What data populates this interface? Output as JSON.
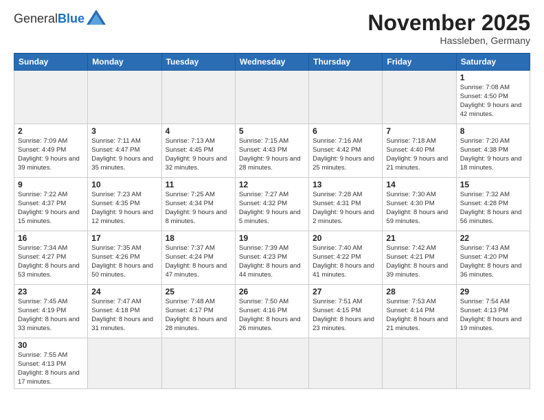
{
  "logo": {
    "general": "General",
    "blue": "Blue"
  },
  "title": {
    "month_year": "November 2025",
    "location": "Hassleben, Germany"
  },
  "weekdays": [
    "Sunday",
    "Monday",
    "Tuesday",
    "Wednesday",
    "Thursday",
    "Friday",
    "Saturday"
  ],
  "weeks": [
    [
      {
        "day": "",
        "info": "",
        "empty": true
      },
      {
        "day": "",
        "info": "",
        "empty": true
      },
      {
        "day": "",
        "info": "",
        "empty": true
      },
      {
        "day": "",
        "info": "",
        "empty": true
      },
      {
        "day": "",
        "info": "",
        "empty": true
      },
      {
        "day": "",
        "info": "",
        "empty": true
      },
      {
        "day": "1",
        "info": "Sunrise: 7:08 AM\nSunset: 4:50 PM\nDaylight: 9 hours\nand 42 minutes."
      }
    ],
    [
      {
        "day": "2",
        "info": "Sunrise: 7:09 AM\nSunset: 4:49 PM\nDaylight: 9 hours\nand 39 minutes."
      },
      {
        "day": "3",
        "info": "Sunrise: 7:11 AM\nSunset: 4:47 PM\nDaylight: 9 hours\nand 35 minutes."
      },
      {
        "day": "4",
        "info": "Sunrise: 7:13 AM\nSunset: 4:45 PM\nDaylight: 9 hours\nand 32 minutes."
      },
      {
        "day": "5",
        "info": "Sunrise: 7:15 AM\nSunset: 4:43 PM\nDaylight: 9 hours\nand 28 minutes."
      },
      {
        "day": "6",
        "info": "Sunrise: 7:16 AM\nSunset: 4:42 PM\nDaylight: 9 hours\nand 25 minutes."
      },
      {
        "day": "7",
        "info": "Sunrise: 7:18 AM\nSunset: 4:40 PM\nDaylight: 9 hours\nand 21 minutes."
      },
      {
        "day": "8",
        "info": "Sunrise: 7:20 AM\nSunset: 4:38 PM\nDaylight: 9 hours\nand 18 minutes."
      }
    ],
    [
      {
        "day": "9",
        "info": "Sunrise: 7:22 AM\nSunset: 4:37 PM\nDaylight: 9 hours\nand 15 minutes."
      },
      {
        "day": "10",
        "info": "Sunrise: 7:23 AM\nSunset: 4:35 PM\nDaylight: 9 hours\nand 12 minutes."
      },
      {
        "day": "11",
        "info": "Sunrise: 7:25 AM\nSunset: 4:34 PM\nDaylight: 9 hours\nand 8 minutes."
      },
      {
        "day": "12",
        "info": "Sunrise: 7:27 AM\nSunset: 4:32 PM\nDaylight: 9 hours\nand 5 minutes."
      },
      {
        "day": "13",
        "info": "Sunrise: 7:28 AM\nSunset: 4:31 PM\nDaylight: 9 hours\nand 2 minutes."
      },
      {
        "day": "14",
        "info": "Sunrise: 7:30 AM\nSunset: 4:30 PM\nDaylight: 8 hours\nand 59 minutes."
      },
      {
        "day": "15",
        "info": "Sunrise: 7:32 AM\nSunset: 4:28 PM\nDaylight: 8 hours\nand 56 minutes."
      }
    ],
    [
      {
        "day": "16",
        "info": "Sunrise: 7:34 AM\nSunset: 4:27 PM\nDaylight: 8 hours\nand 53 minutes."
      },
      {
        "day": "17",
        "info": "Sunrise: 7:35 AM\nSunset: 4:26 PM\nDaylight: 8 hours\nand 50 minutes."
      },
      {
        "day": "18",
        "info": "Sunrise: 7:37 AM\nSunset: 4:24 PM\nDaylight: 8 hours\nand 47 minutes."
      },
      {
        "day": "19",
        "info": "Sunrise: 7:39 AM\nSunset: 4:23 PM\nDaylight: 8 hours\nand 44 minutes."
      },
      {
        "day": "20",
        "info": "Sunrise: 7:40 AM\nSunset: 4:22 PM\nDaylight: 8 hours\nand 41 minutes."
      },
      {
        "day": "21",
        "info": "Sunrise: 7:42 AM\nSunset: 4:21 PM\nDaylight: 8 hours\nand 39 minutes."
      },
      {
        "day": "22",
        "info": "Sunrise: 7:43 AM\nSunset: 4:20 PM\nDaylight: 8 hours\nand 36 minutes."
      }
    ],
    [
      {
        "day": "23",
        "info": "Sunrise: 7:45 AM\nSunset: 4:19 PM\nDaylight: 8 hours\nand 33 minutes."
      },
      {
        "day": "24",
        "info": "Sunrise: 7:47 AM\nSunset: 4:18 PM\nDaylight: 8 hours\nand 31 minutes."
      },
      {
        "day": "25",
        "info": "Sunrise: 7:48 AM\nSunset: 4:17 PM\nDaylight: 8 hours\nand 28 minutes."
      },
      {
        "day": "26",
        "info": "Sunrise: 7:50 AM\nSunset: 4:16 PM\nDaylight: 8 hours\nand 26 minutes."
      },
      {
        "day": "27",
        "info": "Sunrise: 7:51 AM\nSunset: 4:15 PM\nDaylight: 8 hours\nand 23 minutes."
      },
      {
        "day": "28",
        "info": "Sunrise: 7:53 AM\nSunset: 4:14 PM\nDaylight: 8 hours\nand 21 minutes."
      },
      {
        "day": "29",
        "info": "Sunrise: 7:54 AM\nSunset: 4:13 PM\nDaylight: 8 hours\nand 19 minutes."
      }
    ],
    [
      {
        "day": "30",
        "info": "Sunrise: 7:55 AM\nSunset: 4:13 PM\nDaylight: 8 hours\nand 17 minutes.",
        "last": true
      },
      {
        "day": "",
        "info": "",
        "empty": true,
        "last": true
      },
      {
        "day": "",
        "info": "",
        "empty": true,
        "last": true
      },
      {
        "day": "",
        "info": "",
        "empty": true,
        "last": true
      },
      {
        "day": "",
        "info": "",
        "empty": true,
        "last": true
      },
      {
        "day": "",
        "info": "",
        "empty": true,
        "last": true
      },
      {
        "day": "",
        "info": "",
        "empty": true,
        "last": true
      }
    ]
  ]
}
